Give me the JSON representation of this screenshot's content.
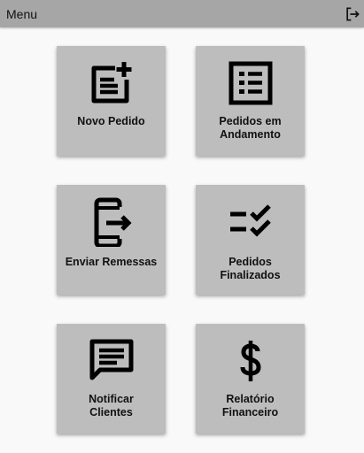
{
  "header": {
    "title": "Menu",
    "logout_icon": "logout-icon"
  },
  "menu": {
    "items": [
      {
        "label": "Novo Pedido",
        "icon": "new-order-icon"
      },
      {
        "label": "Pedidos em\nAndamento",
        "icon": "list-icon"
      },
      {
        "label": "Enviar Remessas",
        "icon": "send-shipment-icon"
      },
      {
        "label": "Pedidos\nFinalizados",
        "icon": "checklist-icon"
      },
      {
        "label": "Notificar\nClientes",
        "icon": "message-icon"
      },
      {
        "label": "Relatório\nFinanceiro",
        "icon": "dollar-icon"
      }
    ]
  }
}
